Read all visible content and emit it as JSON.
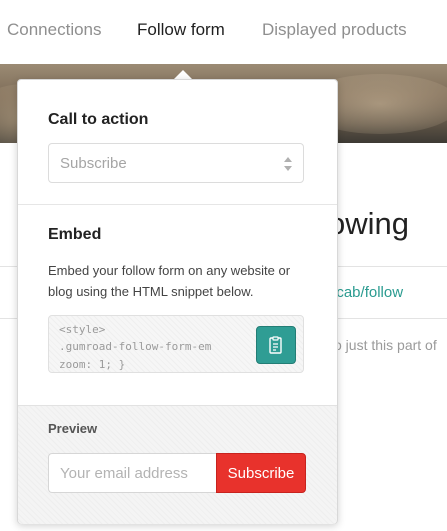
{
  "tabs": [
    {
      "label": "Connections",
      "active": false
    },
    {
      "label": "Follow form",
      "active": true
    },
    {
      "label": "Displayed products",
      "active": false
    }
  ],
  "background_page": {
    "heading_fragment": "owing",
    "link_fragment": "ecab/follow",
    "text_fragment": "o just this part of"
  },
  "popover": {
    "call_to_action": {
      "title": "Call to action",
      "selected_value": "Subscribe"
    },
    "embed": {
      "title": "Embed",
      "description": "Embed your follow form on any website or blog using the HTML snippet below.",
      "code_lines": [
        "<style>",
        "  .gumroad-follow-form-em",
        "    zoom: 1; }"
      ],
      "copy_icon": "copy-clipboard-icon"
    },
    "preview": {
      "label": "Preview",
      "email_placeholder": "Your email address",
      "email_value": "",
      "button_label": "Subscribe"
    }
  },
  "colors": {
    "accent_teal": "#2f9d94",
    "subscribe_red": "#e8322c",
    "link_teal": "#2a9b90"
  }
}
